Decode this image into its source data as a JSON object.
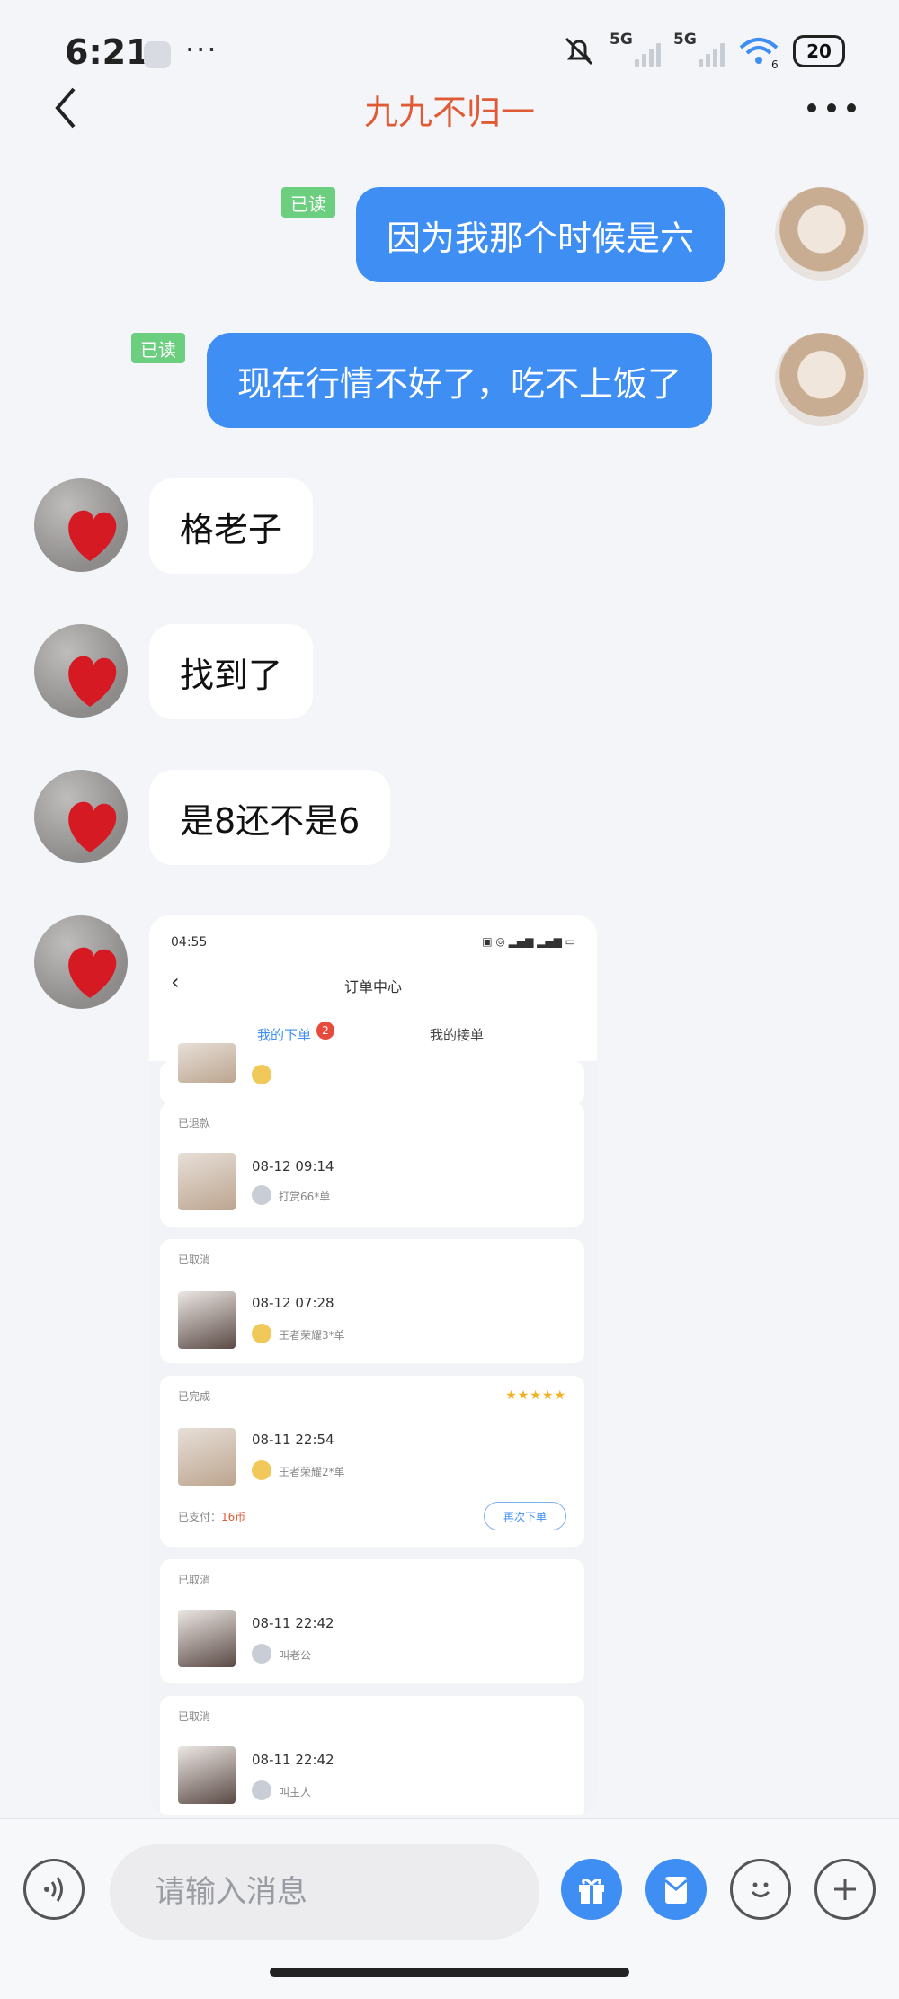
{
  "status_bar": {
    "time": "6:21",
    "more": "···",
    "sim1": "5G",
    "sim2": "5G",
    "wifi_num": "6",
    "battery": "20"
  },
  "header": {
    "title": "九九不归一"
  },
  "messages": [
    {
      "side": "out",
      "text": "因为我那个时候是六",
      "read": "已读"
    },
    {
      "side": "out",
      "text": "现在行情不好了，吃不上饭了",
      "read": "已读"
    },
    {
      "side": "in",
      "text": "格老子"
    },
    {
      "side": "in",
      "text": "找到了"
    },
    {
      "side": "in",
      "text": "是8还不是6"
    }
  ],
  "image_message": {
    "time": "04:55",
    "title": "订单中心",
    "tabs": [
      "我的下单",
      "我的接单"
    ],
    "tab_badge": "2",
    "cards": [
      {
        "status": "已退款",
        "date": "08-12 09:14",
        "service": "打赏66*单"
      },
      {
        "status": "已取消",
        "date": "08-12 07:28",
        "service": "王者荣耀3*单"
      },
      {
        "status": "已完成",
        "date": "08-11 22:54",
        "service": "王者荣耀2*单",
        "stars": "★★★★★",
        "paid_label": "已支付：",
        "paid_value": "16币",
        "button": "再次下单"
      },
      {
        "status": "已取消",
        "date": "08-11 22:42",
        "service": "叫老公"
      },
      {
        "status": "已取消",
        "date": "08-11 22:42",
        "service": "叫主人"
      }
    ]
  },
  "composer": {
    "placeholder": "请输入消息"
  },
  "colors": {
    "accent": "#3e8ef4",
    "title": "#e05a35",
    "read_badge": "#6ccf80"
  }
}
